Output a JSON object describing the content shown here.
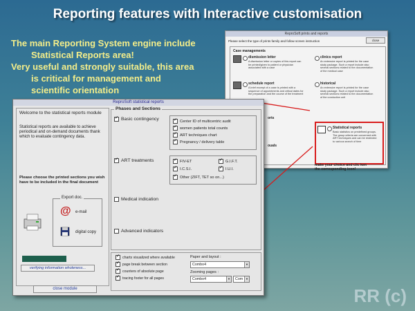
{
  "slide": {
    "title": "Reporting features with Interactive customisation",
    "bullet1_l1": "The main Reporting System engine include",
    "bullet1_l2": "Statistical Reports area!",
    "bullet2_l1": "Very useful and strongly suitable, this area",
    "bullet2_l2": "is critical for management and",
    "bullet2_l3": "scientific orientation",
    "watermark": "RR (c)"
  },
  "back_window": {
    "title": "ReproSoft prints and reports",
    "close_label": "close",
    "instruction": "Please select the type of prints family and follow screen instruction",
    "section_title": "Case managements",
    "items": [
      {
        "name": "dismission letter",
        "desc": "A dismission letter or copies of this report can be printed/given to patient or physician associated with a case"
      },
      {
        "name": "clinics report",
        "desc": "An extensive report is printed for the case study package. Such a report include also several sections related to the documentation of the medical case"
      },
      {
        "name": "schedule report",
        "desc": "A brief excerpt of a case is printed with a sequence of appointments and critical dates for the preparation and the course of the treatment"
      },
      {
        "name": "historical",
        "desc": "An extensive report is printed for the case study package. Such a report include also several sections related to the documentation of the conduction unit"
      },
      {
        "name": "Statistical reports",
        "desc": "Basic statistics on predefined groups. The group criteria are concerned with ART techniques and can be restricted to various search of time"
      }
    ],
    "partial_left_1": "orts",
    "partial_left_2": "ouals",
    "bottom_l1": "make your choice and clic ken",
    "bottom_l2": "the corresponding icon!"
  },
  "main_window": {
    "title": "ReproSoft statistical reports",
    "welcome": "Welcome to the statistical reports module",
    "description": "Statistical reports are available to achieve periodical and on-demand documents thank which to evaluate contingency data.",
    "choose": "Please choose the printed sections you wish have to be included in the final document",
    "export_title": "Export doc.",
    "email_label": "e-mail",
    "digital_copy_label": "digital copy",
    "verify_label": "verifying information wholeness...",
    "close_label": "close module",
    "phases_title": "Phases and Sections",
    "basic": {
      "label": "Basic contingency",
      "checked": true,
      "items": [
        {
          "label": "Center ID of multicentric audit",
          "checked": true
        },
        {
          "label": "women patients total counts",
          "checked": true
        },
        {
          "label": "ART techniques chart",
          "checked": true
        },
        {
          "label": "Pregnancy / delivery table",
          "checked": true
        }
      ]
    },
    "art": {
      "label": "ART treatments",
      "checked": true,
      "items": [
        {
          "label": "FIV-ET",
          "checked": true
        },
        {
          "label": "G.I.F.T.",
          "checked": true
        },
        {
          "label": "I.C.S.I.",
          "checked": true
        },
        {
          "label": "I.U.I.",
          "checked": true
        },
        {
          "label": "Other (ZIFT, TET so on...)",
          "checked": true
        }
      ]
    },
    "medical": {
      "label": "Medical indication",
      "checked": false
    },
    "advanced": {
      "label": "Advanced indicators",
      "checked": false
    },
    "options": [
      {
        "label": "charts visualized where available",
        "checked": true
      },
      {
        "label": "page break between section",
        "checked": true
      },
      {
        "label": "counters of absolute page",
        "checked": true
      },
      {
        "label": "tracing footer for all pages",
        "checked": true
      }
    ],
    "paper_label": "Paper and layout :",
    "paper_combo": "Combo4",
    "zoom_label": "Zooming pages :",
    "zoom_combo": "Combo4",
    "zoom_combo2": "Com"
  },
  "colors": {
    "accent_text": "#f4ee8a",
    "highlight": "#d81b1b",
    "title_bar": "#d2d6e2"
  }
}
